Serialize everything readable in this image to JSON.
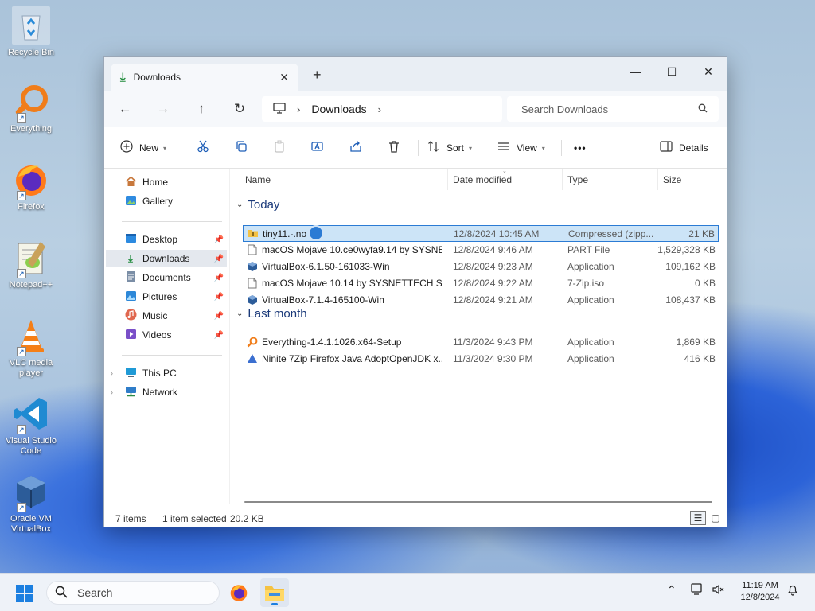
{
  "desktop": {
    "icons": [
      {
        "label": "Recycle Bin",
        "icon": "recycle-bin-icon"
      },
      {
        "label": "Everything",
        "icon": "everything-search-icon"
      },
      {
        "label": "Firefox",
        "icon": "firefox-icon"
      },
      {
        "label": "Notepad++",
        "icon": "notepadpp-icon"
      },
      {
        "label": "VLC media player",
        "icon": "vlc-icon"
      },
      {
        "label": "Visual Studio Code",
        "icon": "vscode-icon"
      },
      {
        "label": "Oracle VM VirtualBox",
        "icon": "virtualbox-icon"
      }
    ]
  },
  "window": {
    "tab_title": "Downloads",
    "tab_close": "✕",
    "new_tab": "+",
    "controls": {
      "minimize": "—",
      "maximize": "☐",
      "close": "✕"
    }
  },
  "nav": {
    "back": "←",
    "forward": "→",
    "up": "↑",
    "refresh": "↻",
    "address_segment": "Downloads",
    "search_placeholder": "Search Downloads"
  },
  "commands": {
    "new": "New",
    "sort": "Sort",
    "view": "View",
    "more": "•••",
    "details": "Details"
  },
  "sidebar": {
    "quick": [
      {
        "label": "Home",
        "icon": "home-icon"
      },
      {
        "label": "Gallery",
        "icon": "gallery-icon"
      }
    ],
    "pinned": [
      {
        "label": "Desktop",
        "icon": "desktop-folder-icon"
      },
      {
        "label": "Downloads",
        "icon": "downloads-folder-icon",
        "selected": true
      },
      {
        "label": "Documents",
        "icon": "documents-folder-icon"
      },
      {
        "label": "Pictures",
        "icon": "pictures-folder-icon"
      },
      {
        "label": "Music",
        "icon": "music-folder-icon"
      },
      {
        "label": "Videos",
        "icon": "videos-folder-icon"
      }
    ],
    "drives": [
      {
        "label": "This PC",
        "icon": "this-pc-icon"
      },
      {
        "label": "Network",
        "icon": "network-icon"
      }
    ]
  },
  "list": {
    "columns": [
      "Name",
      "Date modified",
      "Type",
      "Size"
    ],
    "groups": [
      {
        "label": "Today",
        "rows": [
          {
            "name": "tiny11.-.no",
            "date": "12/8/2024 10:45 AM",
            "type": "Compressed (zipp...",
            "size": "21 KB",
            "icon": "zip-folder-icon",
            "selected": true
          },
          {
            "name": "macOS Mojave 10.ce0wyfa9.14 by SYSNE...",
            "date": "12/8/2024 9:46 AM",
            "type": "PART File",
            "size": "1,529,328 KB",
            "icon": "file-icon"
          },
          {
            "name": "VirtualBox-6.1.50-161033-Win",
            "date": "12/8/2024 9:23 AM",
            "type": "Application",
            "size": "109,162 KB",
            "icon": "virtualbox-installer-icon"
          },
          {
            "name": "macOS Mojave 10.14 by SYSNETTECH So...",
            "date": "12/8/2024 9:22 AM",
            "type": "7-Zip.iso",
            "size": "0 KB",
            "icon": "file-icon"
          },
          {
            "name": "VirtualBox-7.1.4-165100-Win",
            "date": "12/8/2024 9:21 AM",
            "type": "Application",
            "size": "108,437 KB",
            "icon": "virtualbox-installer-icon"
          }
        ]
      },
      {
        "label": "Last month",
        "rows": [
          {
            "name": "Everything-1.4.1.1026.x64-Setup",
            "date": "11/3/2024 9:43 PM",
            "type": "Application",
            "size": "1,869 KB",
            "icon": "everything-setup-icon"
          },
          {
            "name": "Ninite 7Zip Firefox Java AdoptOpenJDK x...",
            "date": "11/3/2024 9:30 PM",
            "type": "Application",
            "size": "416 KB",
            "icon": "ninite-icon"
          }
        ]
      }
    ]
  },
  "status": {
    "items": "7 items",
    "selected": "1 item selected",
    "selected_size": "20.2 KB"
  },
  "taskbar": {
    "search_label": "Search",
    "time": "11:19 AM",
    "date": "12/8/2024"
  }
}
